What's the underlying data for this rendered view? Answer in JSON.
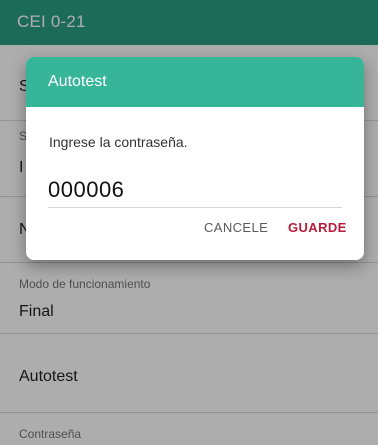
{
  "app_bar": {
    "title": "CEI 0-21"
  },
  "settings": {
    "partial_1": "S",
    "partial_2_small": "S",
    "partial_2_big": "I",
    "partial_3": "N",
    "operating_mode": {
      "label": "Modo de funcionamiento",
      "value": "Final"
    },
    "autotest": {
      "label": "Autotest"
    },
    "password": {
      "label": "Contraseña"
    }
  },
  "dialog": {
    "title": "Autotest",
    "message": "Ingrese la contraseña.",
    "input_value": "000006",
    "cancel_label": "CANCELE",
    "save_label": "GUARDE"
  },
  "colors": {
    "app_bar": "#2a9e84",
    "dialog_header": "#37b599",
    "save_button": "#b71c3a"
  }
}
